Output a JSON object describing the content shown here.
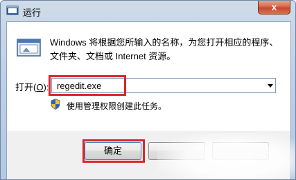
{
  "window": {
    "title": "运行",
    "close_glyph": "x"
  },
  "main": {
    "description": "Windows 将根据您所输入的名称，为您打开相应的程序、文件夹、文档或 Internet 资源。",
    "open_label_prefix": "打开(",
    "open_label_accel": "O",
    "open_label_suffix": "):",
    "input_value": "regedit.exe",
    "admin_note": "使用管理权限创建此任务。"
  },
  "buttons": {
    "ok_label": "确定"
  },
  "colors": {
    "highlight": "#d9252b",
    "titlebar": "#bcd0e6",
    "close_button": "#c24a2b"
  },
  "icons": {
    "title": "run-app-icon",
    "dialog": "run-window-icon",
    "uac": "uac-shield-icon"
  }
}
